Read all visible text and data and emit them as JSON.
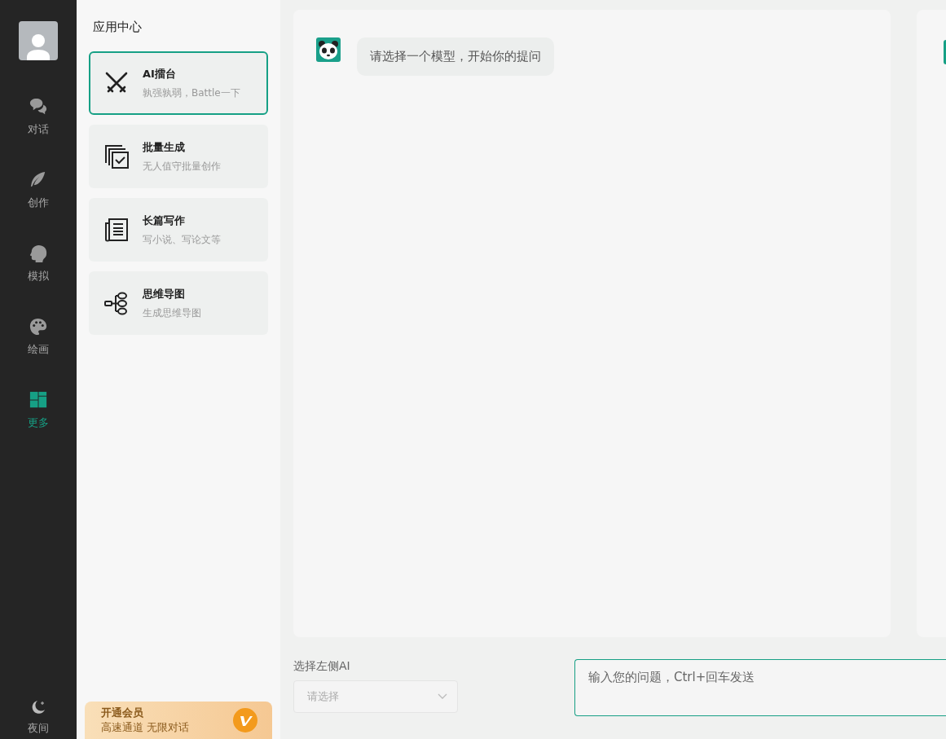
{
  "nav": {
    "items": [
      {
        "label": "对话",
        "selected": false
      },
      {
        "label": "创作",
        "selected": false
      },
      {
        "label": "模拟",
        "selected": false
      },
      {
        "label": "绘画",
        "selected": false
      },
      {
        "label": "更多",
        "selected": true
      }
    ],
    "night": {
      "label": "夜间"
    }
  },
  "apps": {
    "title": "应用中心",
    "items": [
      {
        "title": "AI擂台",
        "subtitle": "孰强孰弱，Battle一下",
        "selected": true
      },
      {
        "title": "批量生成",
        "subtitle": "无人值守批量创作",
        "selected": false
      },
      {
        "title": "长篇写作",
        "subtitle": "写小说、写论文等",
        "selected": false
      },
      {
        "title": "思维导图",
        "subtitle": "生成思维导图",
        "selected": false
      }
    ]
  },
  "promo": {
    "title": "开通会员",
    "subtitle": "高速通道 无限对话"
  },
  "chat": {
    "message": "请选择一个模型，开始你的提问"
  },
  "model_select": {
    "label": "选择左侧AI",
    "placeholder": "请选择"
  },
  "question": {
    "placeholder": "输入您的问题，Ctrl+回车发送"
  }
}
